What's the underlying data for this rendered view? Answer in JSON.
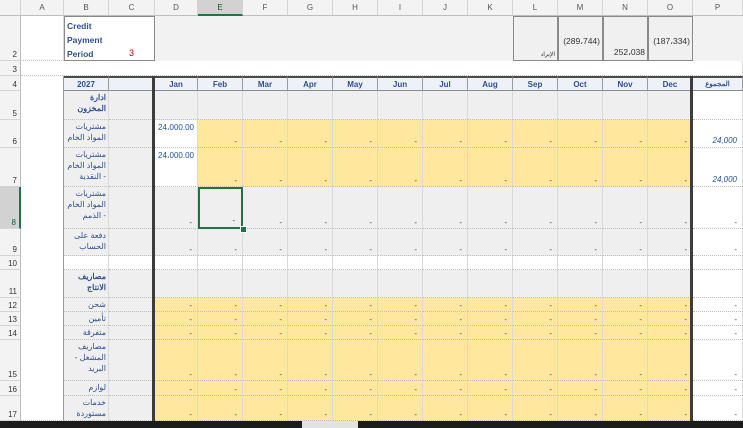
{
  "columns": [
    "A",
    "B",
    "C",
    "D",
    "E",
    "F",
    "G",
    "H",
    "I",
    "J",
    "K",
    "L",
    "M",
    "N",
    "O",
    "P"
  ],
  "selected_column": "E",
  "rows": [
    "2",
    "3",
    "4",
    "5",
    "6",
    "7",
    "8",
    "9",
    "10",
    "11",
    "12",
    "13",
    "14",
    "15",
    "16",
    "17"
  ],
  "selected_row": "8",
  "credit": {
    "label": "Credit Payment Period",
    "value": "3"
  },
  "top_values": {
    "L": "الإيراد",
    "M": "(289،744)",
    "N": "252،038",
    "O": "(187،334)"
  },
  "header": {
    "year": "2027",
    "months": [
      "Jan",
      "Feb",
      "Mar",
      "Apr",
      "May",
      "Jun",
      "Jul",
      "Aug",
      "Sep",
      "Oct",
      "Nov",
      "Dec"
    ],
    "total": "المجموع"
  },
  "labels": {
    "r5": "ادارة المخزون",
    "r6": "مشتريات المواد الخام",
    "r7": "مشتريات المواد الخام - النقدية",
    "r8": "مشتريات المواد الخام - الذمم",
    "r9": "دفعة على الحساب",
    "r11": "مصاريف الانتاج",
    "r12": "شحن",
    "r13": "تأمين",
    "r14": "متفرقة",
    "r15": "مصاريف المشغل - البريد",
    "r16": "لوازم مشغل",
    "r17": "خدمات مستوردة"
  },
  "values": {
    "jan_r6": "24،000.00",
    "jan_r7": "24،000.00",
    "total_r6": "24,000",
    "total_r7": "24,000",
    "dash": "-"
  }
}
